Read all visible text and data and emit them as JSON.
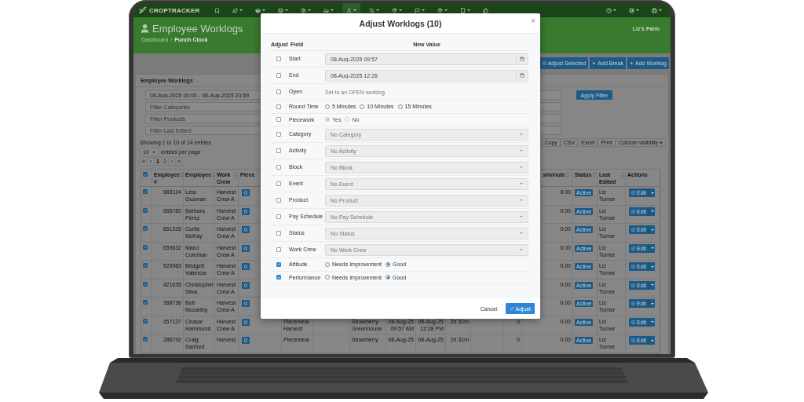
{
  "navbar": {
    "brand": "CROPTRACKER",
    "items": [
      {
        "kind": "bookmark",
        "menu": false,
        "selected": false
      },
      {
        "kind": "leaf",
        "menu": true,
        "selected": false
      },
      {
        "kind": "basket",
        "menu": true,
        "selected": false
      },
      {
        "kind": "layers",
        "menu": true,
        "selected": false
      },
      {
        "kind": "gear",
        "menu": true,
        "selected": false
      },
      {
        "kind": "car",
        "menu": true,
        "selected": false
      },
      {
        "kind": "person",
        "menu": true,
        "selected": true
      },
      {
        "kind": "arrows",
        "menu": true,
        "selected": false
      },
      {
        "kind": "pin",
        "menu": true,
        "selected": false
      },
      {
        "kind": "flag",
        "menu": true,
        "selected": false
      },
      {
        "kind": "pin",
        "menu": true,
        "selected": false
      },
      {
        "kind": "phone",
        "menu": true,
        "selected": false
      },
      {
        "kind": "thumb",
        "menu": false,
        "selected": false
      }
    ],
    "right_items": [
      {
        "kind": "help",
        "menu": true,
        "selected": false
      },
      {
        "kind": "support",
        "menu": true,
        "selected": false
      },
      {
        "kind": "briefcase",
        "menu": true,
        "selected": false
      }
    ]
  },
  "header": {
    "title": "Employee Worklogs",
    "breadcrumb": [
      {
        "label": "Dashboard",
        "selected": false
      },
      {
        "label": "Punch Clock",
        "selected": true
      }
    ],
    "separator": "/",
    "farm": "Liz's Farm"
  },
  "actions": [
    {
      "kind": "edit",
      "label": "Adjust Selected"
    },
    {
      "kind": "add",
      "label": "Add Break"
    },
    {
      "kind": "add",
      "label": "Add Worklog"
    }
  ],
  "panel": {
    "title": "Employee Worklogs",
    "filters": [
      {
        "value": "08-Aug-2025 00:00 - 08-Aug-2025 23:59"
      },
      {
        "placeholder": "Filter Categories"
      },
      {
        "placeholder": "Filter Products"
      },
      {
        "placeholder": "Filter Last Edited"
      }
    ],
    "apply": "Apply Filter",
    "showing": "Showing 1 to 10 of 14 entries",
    "page_size": "10",
    "page_size_suffix": "entries per page",
    "pagination": [
      {
        "label": "«",
        "selected": false
      },
      {
        "label": "‹",
        "selected": false
      },
      {
        "label": "1",
        "selected": true
      },
      {
        "label": "2",
        "selected": false
      },
      {
        "label": "›",
        "selected": false
      },
      {
        "label": "»",
        "selected": false
      }
    ],
    "export_buttons": [
      {
        "label": "Copy",
        "menu": false
      },
      {
        "label": "CSV",
        "menu": false
      },
      {
        "label": "Excel",
        "menu": false
      },
      {
        "label": "Print",
        "menu": false
      },
      {
        "label": "Column visibility",
        "menu": true
      }
    ]
  },
  "table": {
    "header_checked": true,
    "left_columns": [
      "Employee #",
      "Employee",
      "Work Crew",
      "Piece"
    ],
    "right_columns": [
      "s/minute",
      "Status",
      "Last Edited",
      "Actions"
    ],
    "rows": [
      {
        "checked": true,
        "number": "983124",
        "employee": "Leta Guzman",
        "crew": "Harvest Crew A",
        "badge": "0",
        "rate": "0.00",
        "status": "Active",
        "edited": "Liz Turner",
        "action": "Edit"
      },
      {
        "checked": true,
        "number": "965782",
        "employee": "Barbara Perez",
        "crew": "Harvest Crew A",
        "badge": "0",
        "rate": "0.00",
        "status": "Active",
        "edited": "Liz Turner",
        "action": "Edit"
      },
      {
        "checked": true,
        "number": "861325",
        "employee": "Curtis McKay",
        "crew": "Harvest Crew A",
        "badge": "0",
        "rate": "0.00",
        "status": "Active",
        "edited": "Liz Turner",
        "action": "Edit"
      },
      {
        "checked": true,
        "number": "659832",
        "employee": "Marci Coleman",
        "crew": "Harvest Crew A",
        "badge": "0",
        "rate": "0.00",
        "status": "Active",
        "edited": "Liz Turner",
        "action": "Edit"
      },
      {
        "checked": true,
        "number": "526983",
        "employee": "Bridgett Valencia",
        "crew": "Harvest Crew A",
        "badge": "0",
        "rate": "0.00",
        "status": "Active",
        "edited": "Liz Turner",
        "action": "Edit"
      },
      {
        "checked": true,
        "number": "421635",
        "employee": "Christopher Silva",
        "crew": "Harvest Crew A",
        "badge": "0",
        "rate": "0.00",
        "status": "Active",
        "edited": "Liz Turner",
        "action": "Edit"
      },
      {
        "checked": true,
        "number": "368736",
        "employee": "Bob Mccarthy",
        "crew": "Harvest Crew A",
        "badge": "0",
        "rate": "0.00",
        "status": "Active",
        "edited": "Liz Turner",
        "action": "Edit"
      },
      {
        "checked": true,
        "number": "357137",
        "employee": "Ceasar Hammond",
        "crew": "Harvest Crew A",
        "badge": "0",
        "activity": "Piecemeal Harvest",
        "block": "Strawberry Greenhouse",
        "start": "08-Aug-25 09:57 AM",
        "end": "08-Aug-25 12:28 PM",
        "duration": "2h 31m",
        "units": "0",
        "rate": "0.00",
        "status": "Active",
        "edited": "Liz Turner",
        "action": "Edit"
      },
      {
        "checked": true,
        "number": "286792",
        "employee": "Craig Sanford",
        "crew": "Harvest",
        "badge": "0",
        "activity": "Piecemeal",
        "block": "Strawberry",
        "start": "08-Aug-25",
        "end": "08-Aug-25",
        "duration": "2h 31m",
        "units": "0",
        "rate": "0.00",
        "status": "Active",
        "edited": "Liz Turner",
        "action": "Edit"
      }
    ]
  },
  "modal": {
    "title": "Adjust Worklogs (10)",
    "close": "×",
    "columns": [
      "Adjust",
      "Field",
      "New Value"
    ],
    "rows": [
      {
        "kind": "datetime",
        "label": "Start",
        "checked": false,
        "value": "08-Aug-2025 09:57"
      },
      {
        "kind": "datetime",
        "label": "End",
        "checked": false,
        "value": "08-Aug-2025 12:28"
      },
      {
        "kind": "note",
        "label": "Open",
        "checked": false,
        "text": "Set to an OPEN worklog."
      },
      {
        "kind": "radio",
        "label": "Round Time",
        "checked": false,
        "disabled": false,
        "options": [
          {
            "label": "5 Minutes",
            "selected": false
          },
          {
            "label": "10 Minutes",
            "selected": false
          },
          {
            "label": "15 Minutes",
            "selected": false
          }
        ]
      },
      {
        "kind": "radio",
        "label": "Piecework",
        "checked": false,
        "disabled": true,
        "options": [
          {
            "label": "Yes",
            "selected": true
          },
          {
            "label": "No",
            "selected": false
          }
        ]
      },
      {
        "kind": "select",
        "label": "Category",
        "checked": false,
        "placeholder": "No Category"
      },
      {
        "kind": "select",
        "label": "Activity",
        "checked": false,
        "placeholder": "No Activity"
      },
      {
        "kind": "select",
        "label": "Block",
        "checked": false,
        "placeholder": "No Block"
      },
      {
        "kind": "select",
        "label": "Event",
        "checked": false,
        "placeholder": "No Event"
      },
      {
        "kind": "select",
        "label": "Product",
        "checked": false,
        "placeholder": "No Product"
      },
      {
        "kind": "select",
        "label": "Pay Schedule",
        "checked": false,
        "placeholder": "No Pay Schedule"
      },
      {
        "kind": "select",
        "label": "Status",
        "checked": false,
        "placeholder": "No Status"
      },
      {
        "kind": "select",
        "label": "Work Crew",
        "checked": false,
        "placeholder": "No Work Crew"
      },
      {
        "kind": "radio",
        "label": "Attitude",
        "checked": true,
        "disabled": false,
        "options": [
          {
            "label": "Needs Improvement",
            "selected": false
          },
          {
            "label": "Good",
            "selected": true
          }
        ]
      },
      {
        "kind": "radio",
        "label": "Performance",
        "checked": true,
        "disabled": false,
        "options": [
          {
            "label": "Needs Improvement",
            "selected": false
          },
          {
            "label": "Good",
            "selected": true
          }
        ]
      }
    ],
    "cancel": "Cancel",
    "submit": "Adjust"
  }
}
